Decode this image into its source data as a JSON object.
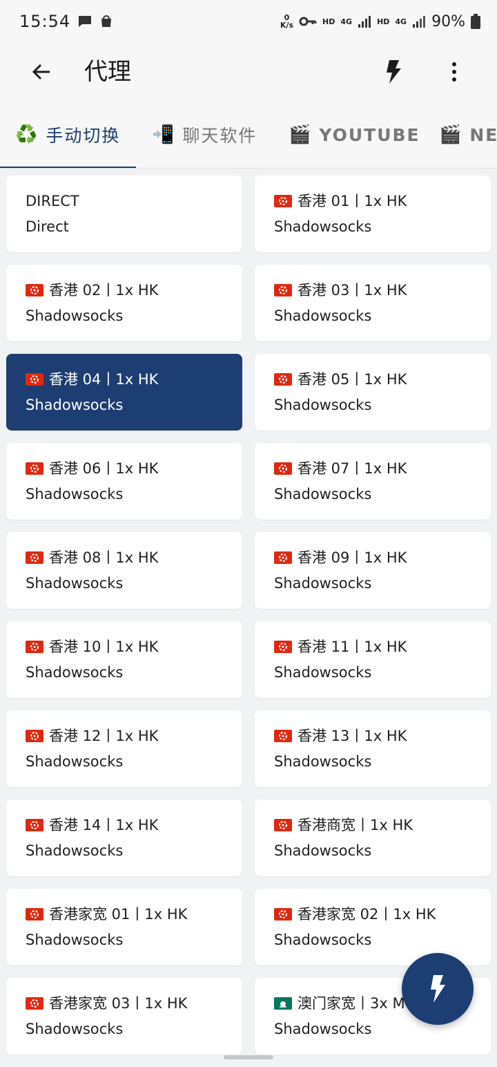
{
  "status_bar": {
    "time": "15:54",
    "net_speed_value": "0",
    "net_speed_unit": "K/s",
    "hd1": "HD",
    "sig1": "4G",
    "hd2": "HD",
    "sig2": "4G",
    "battery": "90%"
  },
  "app_bar": {
    "title": "代理",
    "back_icon": "arrow-back",
    "bolt_icon": "flash",
    "more_icon": "more-vert"
  },
  "tabs": [
    {
      "emoji": "♻️",
      "label": "手动切换",
      "active": true
    },
    {
      "emoji": "📲",
      "label": "聊天软件",
      "active": false
    },
    {
      "emoji": "🎬",
      "label": "YOUTUBE",
      "active": false
    },
    {
      "emoji": "🎬",
      "label": "NETFLIX",
      "active": false
    }
  ],
  "proxies": [
    {
      "name": "DIRECT",
      "type": "Direct",
      "flag": ""
    },
    {
      "name": "香港 01丨1x HK",
      "type": "Shadowsocks",
      "flag": "hk"
    },
    {
      "name": "香港 02丨1x HK",
      "type": "Shadowsocks",
      "flag": "hk"
    },
    {
      "name": "香港 03丨1x HK",
      "type": "Shadowsocks",
      "flag": "hk"
    },
    {
      "name": "香港 04丨1x HK",
      "type": "Shadowsocks",
      "flag": "hk",
      "selected": true
    },
    {
      "name": "香港 05丨1x HK",
      "type": "Shadowsocks",
      "flag": "hk"
    },
    {
      "name": "香港 06丨1x HK",
      "type": "Shadowsocks",
      "flag": "hk"
    },
    {
      "name": "香港 07丨1x HK",
      "type": "Shadowsocks",
      "flag": "hk"
    },
    {
      "name": "香港 08丨1x HK",
      "type": "Shadowsocks",
      "flag": "hk"
    },
    {
      "name": "香港 09丨1x HK",
      "type": "Shadowsocks",
      "flag": "hk"
    },
    {
      "name": "香港 10丨1x HK",
      "type": "Shadowsocks",
      "flag": "hk"
    },
    {
      "name": "香港 11丨1x HK",
      "type": "Shadowsocks",
      "flag": "hk"
    },
    {
      "name": "香港 12丨1x HK",
      "type": "Shadowsocks",
      "flag": "hk"
    },
    {
      "name": "香港 13丨1x HK",
      "type": "Shadowsocks",
      "flag": "hk"
    },
    {
      "name": "香港 14丨1x HK",
      "type": "Shadowsocks",
      "flag": "hk"
    },
    {
      "name": "香港商宽丨1x HK",
      "type": "Shadowsocks",
      "flag": "hk"
    },
    {
      "name": "香港家宽 01丨1x HK",
      "type": "Shadowsocks",
      "flag": "hk"
    },
    {
      "name": "香港家宽 02丨1x HK",
      "type": "Shadowsocks",
      "flag": "hk"
    },
    {
      "name": "香港家宽 03丨1x HK",
      "type": "Shadowsocks",
      "flag": "hk"
    },
    {
      "name": "澳门家宽丨3x MO",
      "type": "Shadowsocks",
      "flag": "mo"
    }
  ],
  "fab": {
    "icon": "flash"
  },
  "colors": {
    "accent": "#1d3e72",
    "background": "#f1f2f4",
    "card": "#ffffff"
  }
}
